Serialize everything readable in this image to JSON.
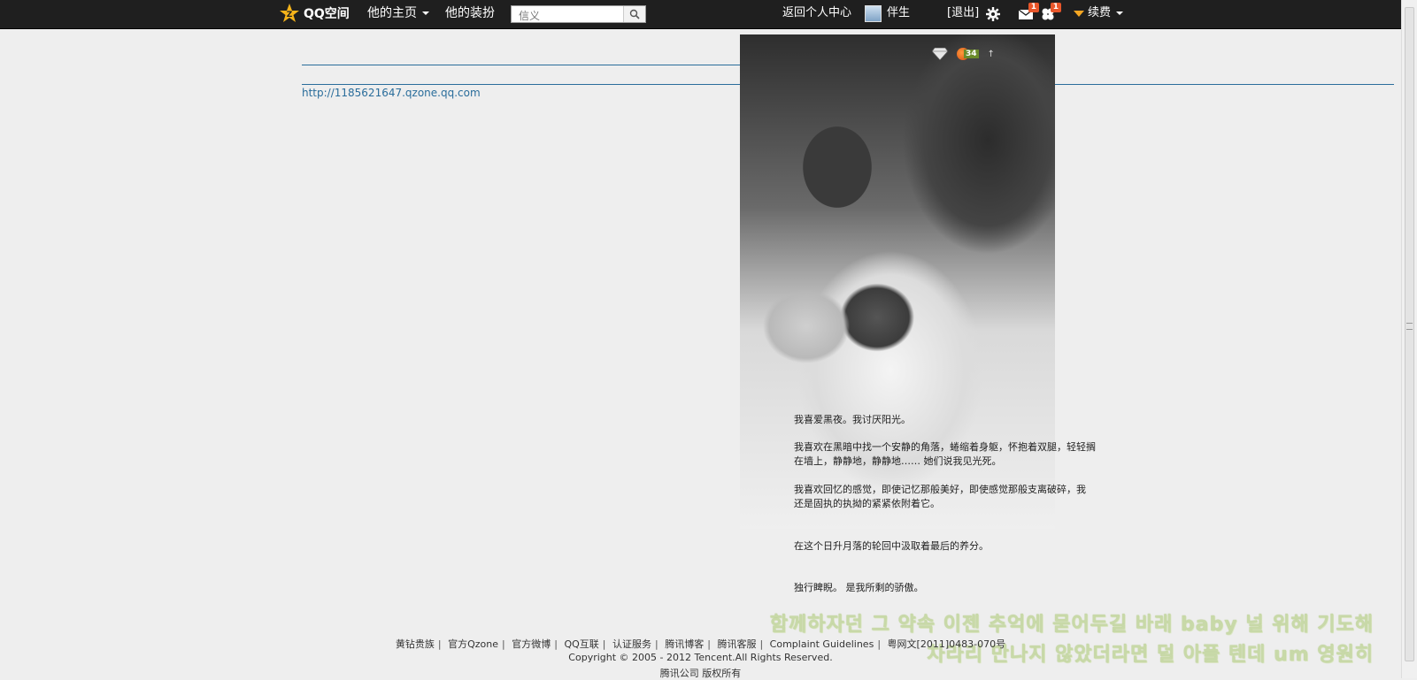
{
  "topbar": {
    "logo_text": "QQ空间",
    "nav_home": "他的主页",
    "nav_dress": "他的装扮",
    "search_placeholder": "信义",
    "back_center": "返回个人中心",
    "username": "伴生",
    "logout": "[退出]",
    "mail_badge": "1",
    "notice_badge": "1",
    "renew": "续费"
  },
  "content": {
    "url": "http://1185621647.qzone.qq.com",
    "fruit_count": "34",
    "poem": {
      "p1": "我喜爱黑夜。我讨厌阳光。",
      "p2": "我喜欢在黑暗中找一个安静的角落，蜷缩着身躯，怀抱着双腿，轻轻搁在墙上，静静地，静静地…… 她们说我见光死。",
      "p3": "我喜欢回忆的感觉，即使记忆那般美好，即使感觉那般支离破碎，我还是固执的执拗的紧紧依附着它。",
      "p4": "在这个日升月落的轮回中汲取着最后的养分。",
      "p5": "独行睥睨。 是我所剩的骄傲。"
    }
  },
  "footer": {
    "links": [
      "黄钻贵族",
      "官方Qzone",
      "官方微博",
      "QQ互联",
      "认证服务",
      "腾讯博客",
      "腾讯客服",
      "Complaint Guidelines",
      "粤网文[2011]0483-070号"
    ],
    "copyright": "Copyright © 2005 - 2012 Tencent.All Rights Reserved.",
    "rights": "腾讯公司 版权所有"
  },
  "lyrics": {
    "line1": "함께하자던 그 약속 이젠 추억에 묻어두길 바래 baby 널 위해 기도해",
    "line2": "차라리 만나지 않았더라면 덜 아플 텐데 um 영원히"
  },
  "colors": {
    "topbar": "#1f1f1f",
    "link": "#2a6d9b",
    "page_bg": "#eeeeee",
    "lyric": "#c8d9a8"
  }
}
